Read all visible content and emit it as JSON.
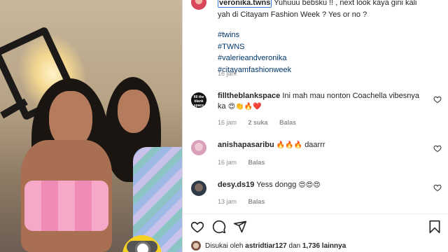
{
  "post": {
    "owner_username": "veronika.twns",
    "caption_text": "Yuhuuu bebsku !! , next look kaya gini kali yah di Citayam Fashion Week ? Yes or no ?",
    "hashtags": [
      "#twins",
      "#TWNS",
      "#valerieandveronika",
      "#citayamfashionweek"
    ],
    "caption_time": "16 jam"
  },
  "comments": [
    {
      "username": "fillthe​blankspace",
      "avatar_text": "fill the blank space",
      "text": "Ini mah mau nonton Coachella vibesnya ka",
      "emojis": "😍👏🔥❤️",
      "time": "16 jam",
      "likes": "2 suka",
      "reply": "Balas"
    },
    {
      "username": "anishapasaribu",
      "text": "",
      "emojis": "🔥🔥🔥",
      "text_after": "daarrr",
      "time": "16 jam",
      "reply": "Balas"
    },
    {
      "username": "desy.ds19",
      "text": "Yess dongg",
      "emojis": "😍😍😍",
      "time": "13 jam",
      "reply": "Balas"
    }
  ],
  "likes_summary": {
    "prefix": "Disukai oleh",
    "user": "astridtiar127",
    "middle": "dan",
    "count": "1,736 lainnya"
  },
  "icons": {
    "like": "heart-icon",
    "comment": "comment-icon",
    "share": "share-icon",
    "save": "bookmark-icon"
  },
  "colors": {
    "hashtag": "#00376b",
    "meta": "#8e8e8e",
    "text": "#262626"
  }
}
